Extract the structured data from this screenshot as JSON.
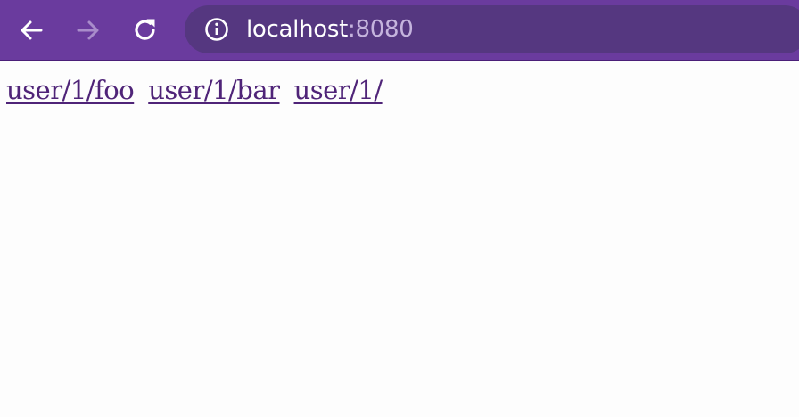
{
  "browser": {
    "address_bar": {
      "host": "localhost",
      "port": ":8080"
    },
    "colors": {
      "toolbar": "#6a3b9e",
      "omnibox": "#553780",
      "link": "#4f2478"
    },
    "icons": {
      "back": "back-arrow-icon",
      "forward": "forward-arrow-icon",
      "reload": "reload-icon",
      "info": "info-icon"
    }
  },
  "page": {
    "links": [
      {
        "label": "user/1/foo"
      },
      {
        "label": "user/1/bar"
      },
      {
        "label": "user/1/"
      }
    ]
  }
}
